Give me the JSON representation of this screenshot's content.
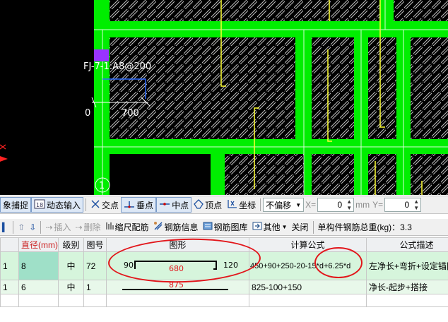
{
  "cad": {
    "label": "FJ-7-1:A8@200",
    "dim_left": "0",
    "dim_right": "700"
  },
  "snap_toolbar": {
    "items": [
      {
        "label": "象捕捉",
        "icon": "snap-object-icon"
      },
      {
        "label": "动态输入",
        "icon": "dynamic-input-icon"
      },
      {
        "label": "交点",
        "icon": "intersection-icon"
      },
      {
        "label": "垂点",
        "icon": "perpendicular-icon"
      },
      {
        "label": "中点",
        "icon": "midpoint-icon"
      },
      {
        "label": "顶点",
        "icon": "vertex-icon"
      },
      {
        "label": "坐标",
        "icon": "coordinate-icon"
      }
    ],
    "offset_select": "不偏移",
    "x_label": "X=",
    "x_value": "0",
    "unit_mm": "mm",
    "y_label": "Y=",
    "y_value": "0"
  },
  "rebar_toolbar": {
    "insert": "插入",
    "delete": "删除",
    "scale_rebar": "缩尺配筋",
    "rebar_info": "钢筋信息",
    "rebar_library": "钢筋图库",
    "other": "其他",
    "close": "关闭",
    "total_weight": "单构件钢筋总重(kg)：3.3"
  },
  "table": {
    "headers": [
      "",
      "直径(mm)",
      "级别",
      "图号",
      "图形",
      "计算公式",
      "公式描述"
    ],
    "rows": [
      {
        "idx": "1",
        "diameter": "8",
        "grade": "中",
        "fig_no": "72",
        "shape_left": "90",
        "shape_mid": "680",
        "shape_right": "120",
        "formula": "450+90+250-20-15*d+6.25*d",
        "desc": "左净长+弯折+设定锚固"
      },
      {
        "idx": "1",
        "diameter": "6",
        "grade": "中",
        "fig_no": "1",
        "shape_mid": "875",
        "formula": "825-100+150",
        "desc": "净长-起步+搭接"
      }
    ]
  },
  "colors": {
    "slab_border": "#00ee00",
    "hatch": "#bfbfbf",
    "rebar_yellow": "#ffff33",
    "annotation_red": "#e2161b"
  }
}
